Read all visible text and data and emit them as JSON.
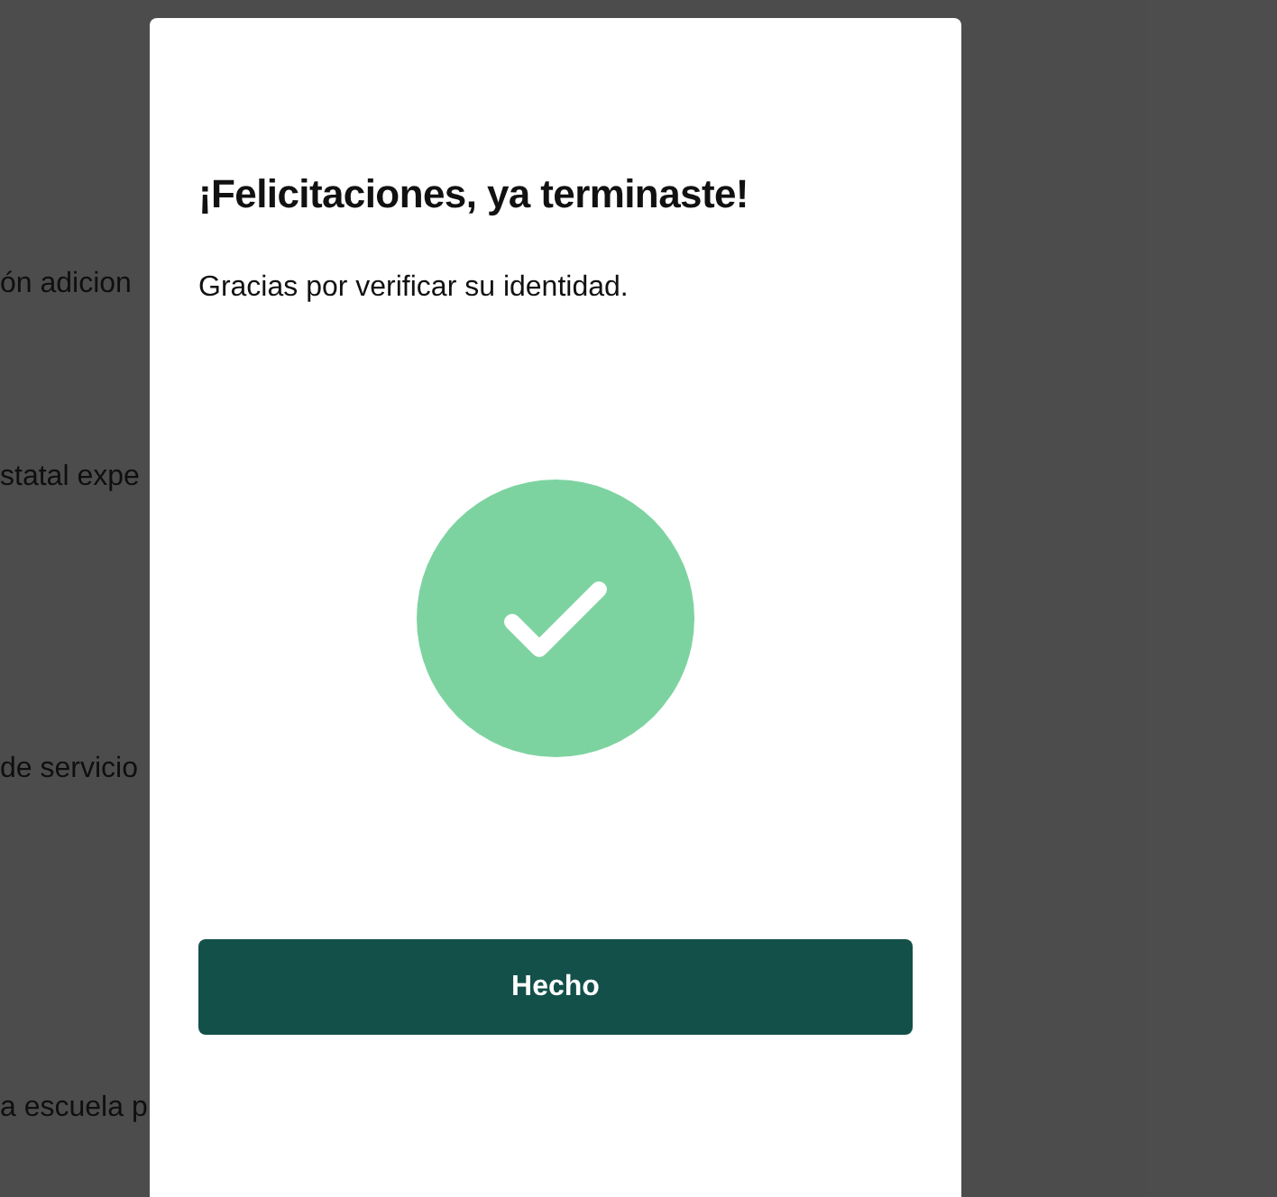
{
  "background_page": {
    "lines": [
      "ón adicion",
      "statal expe",
      "de servicio",
      "a escuela p"
    ]
  },
  "dialog": {
    "title": "¡Felicitaciones, ya terminaste!",
    "message": "Gracias por verificar su identidad.",
    "button": "Hecho"
  }
}
